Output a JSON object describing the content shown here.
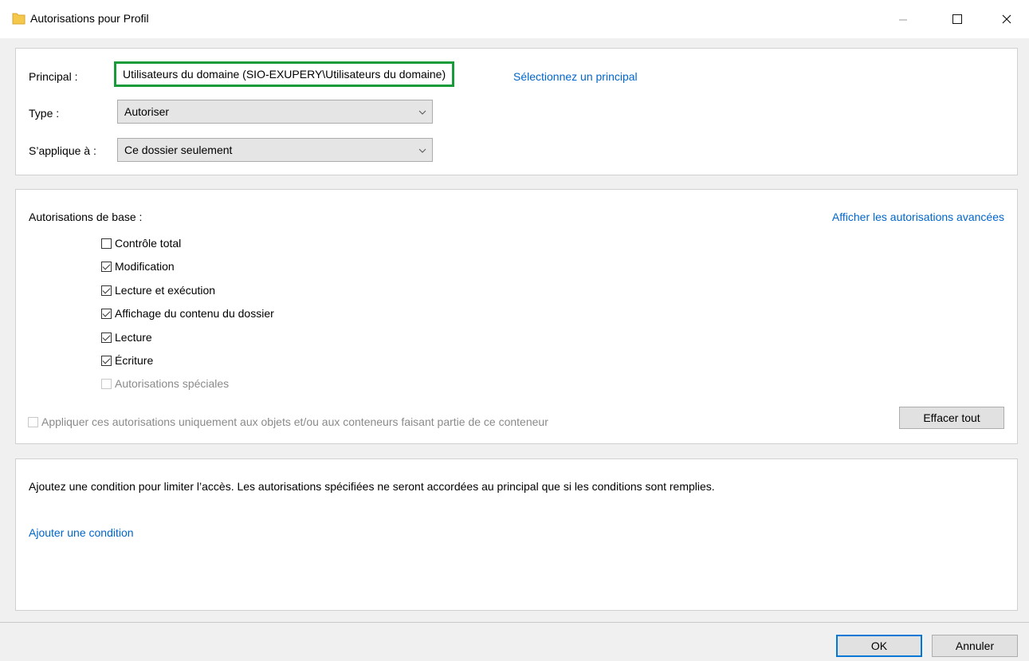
{
  "window": {
    "title": "Autorisations pour Profil",
    "icon": "folder-icon",
    "icon_color": "#f5c84c"
  },
  "principal_section": {
    "principal_label": "Principal :",
    "principal_value": "Utilisateurs du domaine (SIO-EXUPERY\\Utilisateurs du domaine)",
    "principal_highlight_color": "#1a9b3a",
    "select_principal_link": "Sélectionnez un principal",
    "type_label": "Type :",
    "type_value": "Autoriser",
    "applies_label": "S’applique à :",
    "applies_value": "Ce dossier seulement"
  },
  "permissions_section": {
    "heading": "Autorisations de base :",
    "advanced_link": "Afficher les autorisations avancées",
    "items": [
      {
        "label": "Contrôle total",
        "checked": false,
        "enabled": true
      },
      {
        "label": "Modification",
        "checked": true,
        "enabled": true
      },
      {
        "label": "Lecture et exécution",
        "checked": true,
        "enabled": true
      },
      {
        "label": "Affichage du contenu du dossier",
        "checked": true,
        "enabled": true
      },
      {
        "label": "Lecture",
        "checked": true,
        "enabled": true
      },
      {
        "label": "Écriture",
        "checked": true,
        "enabled": true
      },
      {
        "label": "Autorisations spéciales",
        "checked": false,
        "enabled": false
      }
    ],
    "apply_only_label": "Appliquer ces autorisations uniquement aux objets et/ou aux conteneurs faisant partie de ce conteneur",
    "clear_all_button": "Effacer tout"
  },
  "condition_section": {
    "description": "Ajoutez une condition pour limiter l’accès. Les autorisations spécifiées ne seront accordées au principal que si les conditions sont remplies.",
    "add_condition_link": "Ajouter une condition"
  },
  "footer": {
    "ok_button": "OK",
    "cancel_button": "Annuler"
  },
  "colors": {
    "link": "#0066cc",
    "default_button_border": "#0078d7"
  }
}
